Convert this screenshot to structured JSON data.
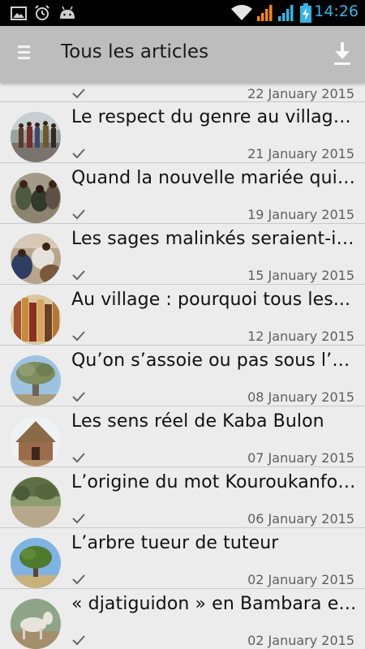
{
  "status_bar": {
    "time": "14:26",
    "icons": [
      "image-icon",
      "alarm-icon",
      "android-icon",
      "wifi-icon",
      "signal-icon",
      "signal-icon",
      "battery-charging-icon"
    ]
  },
  "action_bar": {
    "title": "Tous les articles",
    "menu_icon": "drawer-menu-icon",
    "download_icon": "download-icon"
  },
  "articles": [
    {
      "title": "",
      "date": "22 January 2015",
      "read": true
    },
    {
      "title": "Le respect du genre au village...",
      "date": "21 January 2015",
      "read": true
    },
    {
      "title": "Quand la nouvelle mariée quitte...",
      "date": "19 January 2015",
      "read": true
    },
    {
      "title": "Les sages malinkés seraient-ils...",
      "date": "15 January 2015",
      "read": true
    },
    {
      "title": "Au village : pourquoi tous les...",
      "date": "12 January 2015",
      "read": true
    },
    {
      "title": "Qu’on s’assoie ou pas sous l’arbre...",
      "date": "08 January 2015",
      "read": true
    },
    {
      "title": "Les sens réel de Kaba Bulon",
      "date": "07 January 2015",
      "read": true
    },
    {
      "title": "L’origine du mot Kouroukanfouga...",
      "date": "06 January 2015",
      "read": true
    },
    {
      "title": "L’arbre tueur de tuteur",
      "date": "02 January 2015",
      "read": true
    },
    {
      "title": "« djatiguidon » en Bambara et...",
      "date": "02 January 2015",
      "read": true
    }
  ],
  "colors": {
    "actionbar": "#bdbdbd",
    "background": "#ececec",
    "clock": "#33b5e5",
    "signal": "#ff8a00",
    "battery": "#33b5e5"
  }
}
